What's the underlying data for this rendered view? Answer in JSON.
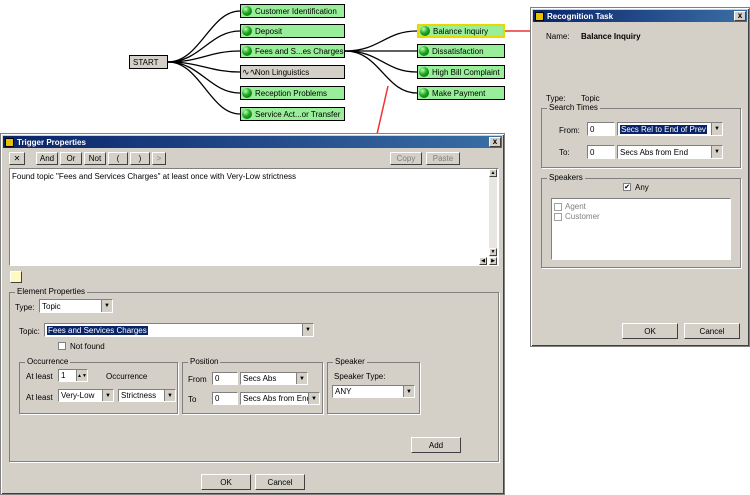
{
  "flow": {
    "start_label": "START",
    "nodes": [
      {
        "label": "Customer Identification",
        "icon": "green-ball-icon"
      },
      {
        "label": "Deposit",
        "icon": "green-ball-icon"
      },
      {
        "label": "Fees and S...es Charges",
        "icon": "green-ball-icon"
      },
      {
        "label": "Non Linguistics",
        "icon": "waveform-icon"
      },
      {
        "label": "Reception Problems",
        "icon": "green-ball-icon"
      },
      {
        "label": "Service Act...or Transfer",
        "icon": "green-ball-icon"
      },
      {
        "label": "Balance Inquiry",
        "icon": "green-ball-icon"
      },
      {
        "label": "Dissatisfaction",
        "icon": "green-ball-icon"
      },
      {
        "label": "High Bill Complaint",
        "icon": "green-ball-icon"
      },
      {
        "label": "Make Payment",
        "icon": "green-ball-icon"
      }
    ],
    "wave_glyph": "∿∿"
  },
  "recognition": {
    "title": "Recognition Task",
    "close": "x",
    "name_label": "Name:",
    "name_value": "Balance Inquiry",
    "type_label": "Type:",
    "type_value": "Topic",
    "search_times_caption": "Search Times",
    "from_label": "From:",
    "from_value": "0",
    "from_unit": "Secs Rel to End of Prev",
    "to_label": "To:",
    "to_value": "0",
    "to_unit": "Secs Abs from End",
    "speakers_caption": "Speakers",
    "any_label": "Any",
    "speakers": [
      "Agent",
      "Customer"
    ],
    "ok": "OK",
    "cancel": "Cancel"
  },
  "trigger": {
    "title": "Trigger Properties",
    "close": "x",
    "toolbar": [
      "And",
      "Or",
      "Not",
      "(",
      ")",
      ">"
    ],
    "delete_glyph": "✕",
    "copy": "Copy",
    "paste": "Paste",
    "expression": "Found topic \"Fees and Services Charges\" at least once with Very-Low strictness",
    "element_caption": "Element Properties",
    "type_label": "Type:",
    "type_value": "Topic",
    "topic_label": "Topic:",
    "topic_value": "Fees and Services Charges",
    "not_found": "Not found",
    "occurrence_caption": "Occurrence",
    "at_least_1": "At least",
    "at_least_value": "1",
    "occurrence_word": "Occurrence",
    "at_least_2": "At least",
    "strictness_value": "Very-Low",
    "strictness_word": "Strictness",
    "position_caption": "Position",
    "from_label": "From",
    "from_value": "0",
    "from_unit": "Secs Abs",
    "to_label": "To",
    "to_value": "0",
    "to_unit": "Secs Abs from End",
    "speaker_caption": "Speaker",
    "speaker_type_label": "Speaker Type:",
    "speaker_type_value": "ANY",
    "add": "Add",
    "ok": "OK",
    "cancel": "Cancel"
  },
  "colors": {
    "node_green": "#99ee99",
    "connector_red": "#ee3333",
    "title_blue": "#0a246a",
    "selected_border": "#e8d800"
  }
}
